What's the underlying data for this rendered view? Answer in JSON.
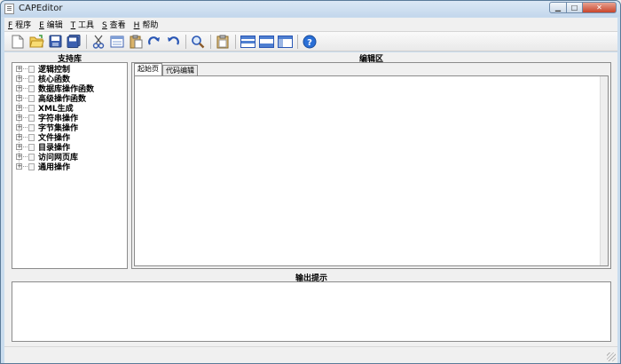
{
  "window": {
    "title": "CAPEditor"
  },
  "menu": [
    {
      "key": "F",
      "label": "程序"
    },
    {
      "key": "E",
      "label": "编辑"
    },
    {
      "key": "T",
      "label": "工具"
    },
    {
      "key": "S",
      "label": "查看"
    },
    {
      "key": "H",
      "label": "帮助"
    }
  ],
  "toolbar_icons": [
    "new-file-icon",
    "open-folder-icon",
    "save-icon",
    "save-all-icon",
    "cut-icon",
    "copy-icon",
    "paste-icon",
    "redo-icon",
    "undo-icon",
    "find-icon",
    "clipboard-icon",
    "layout-1-icon",
    "layout-2-icon",
    "layout-3-icon",
    "help-icon"
  ],
  "library": {
    "header": "支持库",
    "items": [
      "逻辑控制",
      "核心函数",
      "数据库操作函数",
      "高级操作函数",
      "XML生成",
      "字符串操作",
      "字节集操作",
      "文件操作",
      "目录操作",
      "访问网页库",
      "通用操作"
    ]
  },
  "editor": {
    "header": "编辑区",
    "tabs": [
      "起始页",
      "代码编辑"
    ],
    "active_tab": "起始页"
  },
  "output": {
    "header": "输出提示"
  },
  "colors": {
    "help": "#2a6fd6",
    "folder": "#e8b73a",
    "save": "#3b5fb0"
  }
}
